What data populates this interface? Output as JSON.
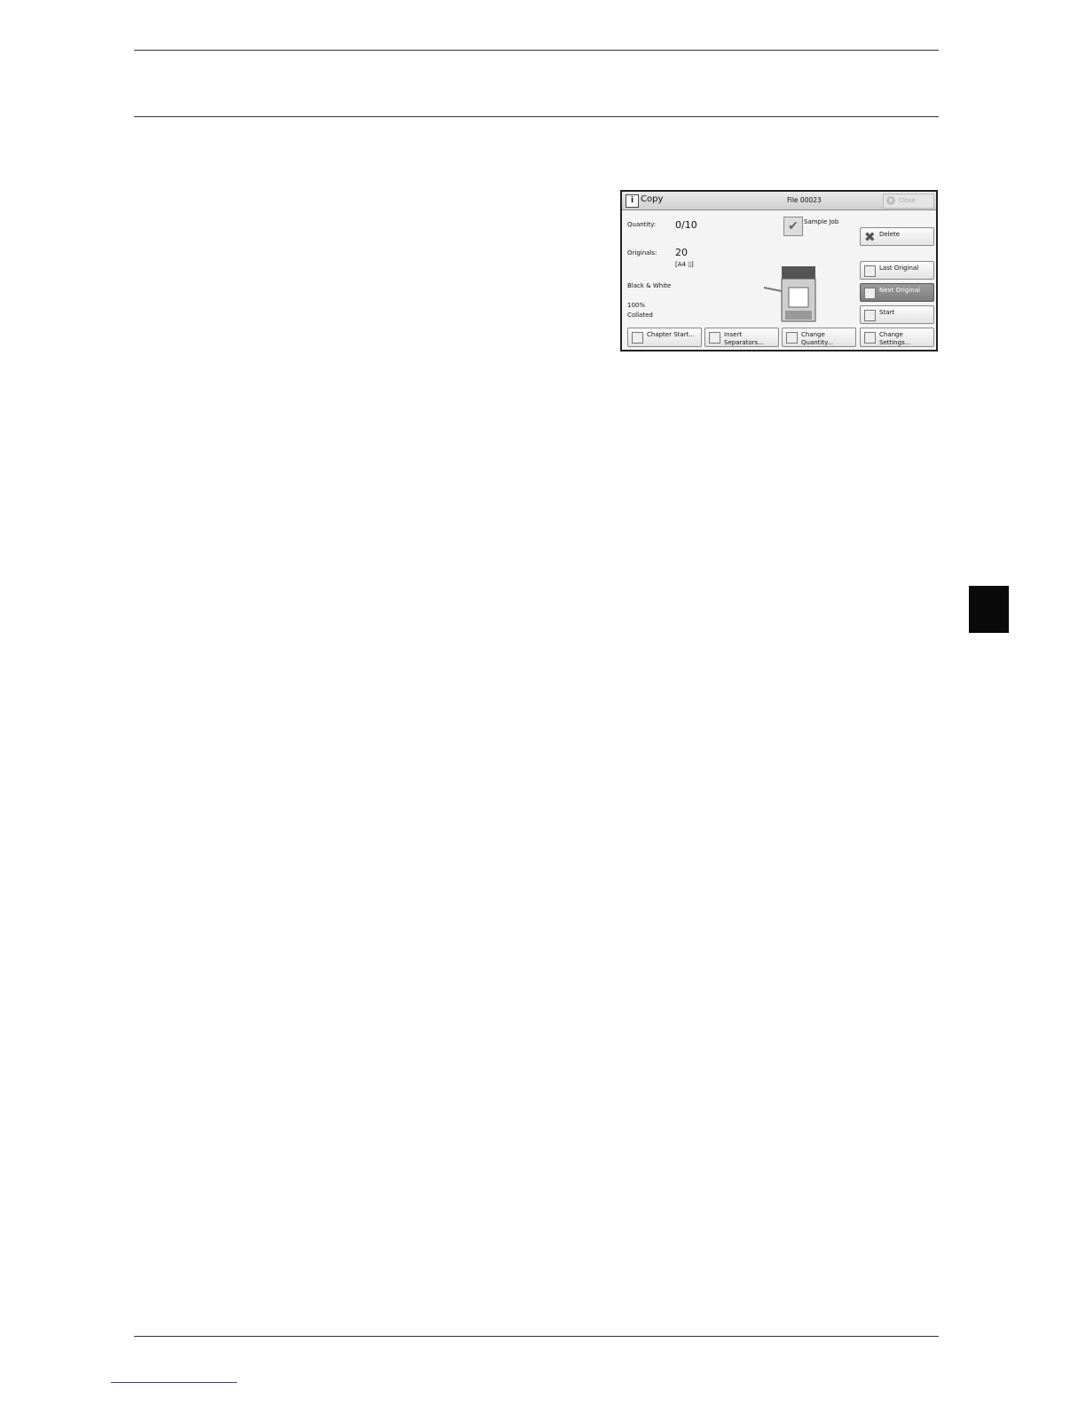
{
  "copy_screen": {
    "title": "Copy",
    "file_label": "File 00023",
    "close_label": "Close",
    "quantity_label": "Quantity:",
    "quantity_value": "0/10",
    "originals_label": "Originals:",
    "originals_value": "20",
    "originals_size": "[A4 ▯]",
    "color_mode": "Black & White",
    "reduce_enlarge": "100%",
    "output": "Collated",
    "sample_job_label": "Sample Job",
    "delete_label": "Delete",
    "last_original_label": "Last Original",
    "next_original_label": "Next Original",
    "start_label": "Start",
    "chapter_start_label": "Chapter Start...",
    "insert_separators_label_1": "Insert",
    "insert_separators_label_2": "Separators...",
    "change_quantity_label_1": "Change",
    "change_quantity_label_2": "Quantity...",
    "change_settings_label_1": "Change",
    "change_settings_label_2": "Settings..."
  }
}
